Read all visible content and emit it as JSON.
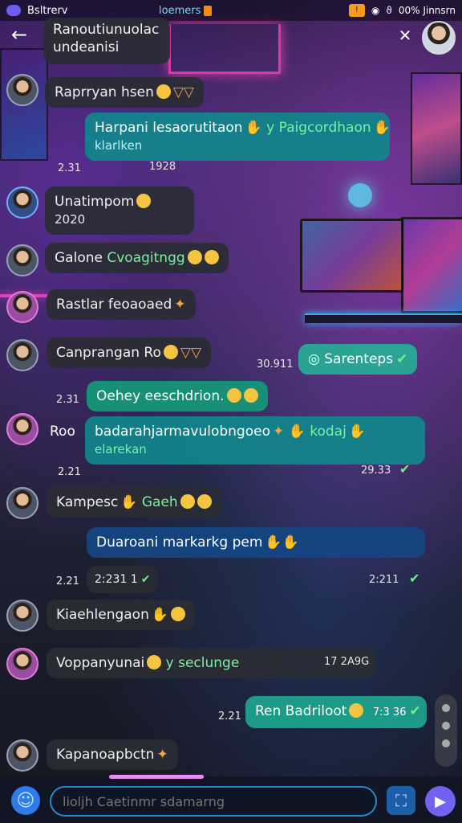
{
  "status_bar": {
    "left_text": "Bsltrerv",
    "center_text": "loemers",
    "right_badge": "!",
    "right_text": "00% Jinnsrn",
    "icons": [
      "signal-icon",
      "wifi-icon",
      "battery-icon"
    ]
  },
  "header": {
    "contact_name": "Ranoutiunuolac undeanisi",
    "back_icon": "back-arrow-icon",
    "close_icon": "close-icon"
  },
  "messages": [
    {
      "text": "Raprryan hsen",
      "time": ""
    },
    {
      "text": "Harpani lesaorutitaon",
      "green": "y Paigcordhaon",
      "sub": "klarlken",
      "time": "2.31",
      "time2": "1928"
    },
    {
      "text": "Unatimpom",
      "sub": "2020",
      "time": ""
    },
    {
      "text": "Galone",
      "green": "Cvoagitngg",
      "time": ""
    },
    {
      "text": "Rastlar feoaoaed",
      "time": ""
    },
    {
      "text": "Canprangan Ro",
      "time": ""
    },
    {
      "text": "Sarenteps",
      "time": "30.911"
    },
    {
      "text": "Oehey eeschdrion.",
      "time": "2.31"
    },
    {
      "text": "Roo",
      "time": "2.21"
    },
    {
      "text": "badarahjarmavulobngoeo",
      "green": "kodaj",
      "sub": "elarekan",
      "time": "29.33"
    },
    {
      "text": "Kampesc",
      "green": "Gaeh",
      "time": ""
    },
    {
      "text": "Duaroani markarkg pem",
      "time": "2:211"
    },
    {
      "text": "2:231 1",
      "time": "2.21"
    },
    {
      "text": "Kiaehlengaon",
      "time": ""
    },
    {
      "text": "Voppanyunai",
      "green": "y seclunge",
      "time": "17 2A9G"
    },
    {
      "text": "Ren Badriloot",
      "time": "7:3 36",
      "time_left": "2.21"
    },
    {
      "text": "Kapanoapbctn",
      "time": ""
    }
  ],
  "composer": {
    "placeholder": "lioljh Caetinmr sdamarng",
    "emoji_icon": "smiley-icon",
    "attach_icon": "attachment-icon",
    "send_icon": "send-icon"
  },
  "colors": {
    "incoming_bubble": "#2a2c34",
    "outgoing_bubble": "#11858c",
    "accent": "#6f63f0"
  }
}
